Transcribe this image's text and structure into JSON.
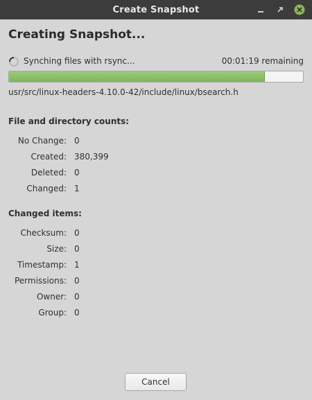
{
  "window": {
    "title": "Create Snapshot"
  },
  "heading": "Creating Snapshot...",
  "status": {
    "text": "Synching files with rsync...",
    "remaining": "00:01:19 remaining",
    "progress_fraction": 0.87,
    "current_file": "usr/src/linux-headers-4.10.0-42/include/linux/bsearch.h"
  },
  "counts": {
    "title": "File and directory counts:",
    "rows": [
      {
        "label": "No Change:",
        "value": "0"
      },
      {
        "label": "Created:",
        "value": "380,399"
      },
      {
        "label": "Deleted:",
        "value": "0"
      },
      {
        "label": "Changed:",
        "value": "1"
      }
    ]
  },
  "changed": {
    "title": "Changed items:",
    "rows": [
      {
        "label": "Checksum:",
        "value": "0"
      },
      {
        "label": "Size:",
        "value": "0"
      },
      {
        "label": "Timestamp:",
        "value": "1"
      },
      {
        "label": "Permissions:",
        "value": "0"
      },
      {
        "label": "Owner:",
        "value": "0"
      },
      {
        "label": "Group:",
        "value": "0"
      }
    ]
  },
  "buttons": {
    "cancel": "Cancel"
  },
  "colors": {
    "titlebar": "#3c3c3c",
    "progress_fill": "#8cbf64",
    "close_button": "#8ab559"
  },
  "icons": {
    "minimize": "minimize-icon",
    "maximize": "maximize-icon",
    "close": "close-icon",
    "spinner": "spinner-icon"
  }
}
